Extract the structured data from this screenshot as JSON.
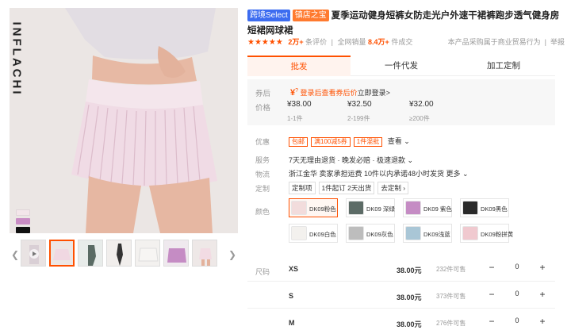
{
  "brand": "INFLACHI",
  "colors": {
    "accent": "#ff5000",
    "badge_blue": "#3c6cf0",
    "badge_orange": "#ff7a2f"
  },
  "gallery": {
    "swatches": [
      "#f3e6ea",
      "#c98cc4",
      "#111111"
    ],
    "thumb_count": 8,
    "prev_icon": "chevron-left-icon",
    "next_icon": "chevron-right-icon"
  },
  "title": {
    "badges": [
      "跨境Select",
      "镇店之宝"
    ],
    "text": "夏季运动健身短裤女防走光户外速干裙裤跑步透气健身房短裙网球裙"
  },
  "rating": {
    "stars": 5,
    "score": "2万+",
    "score_label": "条评价",
    "sales_label": "全网销量",
    "sales": "8.4万+",
    "sales_unit": "件成交",
    "note": "本产品采购属于商业贸易行为",
    "report": "举报"
  },
  "tabs": [
    "批发",
    "一件代发",
    "加工定制"
  ],
  "pricebox": {
    "coupon_label": "券后",
    "coupon_text": "登录后查看券后价",
    "coupon_link": "立即登录>",
    "price_label": "价格",
    "tiers": [
      {
        "price": "¥38.00",
        "qty": "1-1件"
      },
      {
        "price": "¥32.50",
        "qty": "2-199件"
      },
      {
        "price": "¥32.00",
        "qty": "≥200件"
      }
    ]
  },
  "promo": {
    "label": "优惠",
    "tags": [
      "包邮",
      "满100减5券",
      "1件混批"
    ],
    "more": "查看"
  },
  "service": {
    "label": "服务",
    "value": "7天无理由退货 · 晚发必赔 · 极速退款"
  },
  "logistics": {
    "label": "物流",
    "value": "浙江金华  卖家承担运费  10件以内承诺48小时发货  更多"
  },
  "custom": {
    "label": "定制",
    "items": [
      "定制项",
      "1件起订 2天出货",
      "去定制"
    ]
  },
  "color_options": {
    "label": "颜色",
    "items": [
      {
        "name": "DK09粉色",
        "swatch": "#f2dcdc",
        "selected": true
      },
      {
        "name": "DK09 深绿",
        "swatch": "#5c6b66",
        "selected": false
      },
      {
        "name": "DK09 紫色",
        "swatch": "#c58cc4",
        "selected": false
      },
      {
        "name": "DK09黑色",
        "swatch": "#2a2a2a",
        "selected": false
      },
      {
        "name": "DK09白色",
        "swatch": "#f3f1ee",
        "selected": false
      },
      {
        "name": "DK09灰色",
        "swatch": "#bdbdbd",
        "selected": false
      },
      {
        "name": "DK09浅蓝",
        "swatch": "#a9c6d6",
        "selected": false
      },
      {
        "name": "DK09粉拼黄",
        "swatch": "#f0c9cf",
        "selected": false
      }
    ]
  },
  "sizes": {
    "label": "尺码",
    "rows": [
      {
        "size": "XS",
        "price": "38.00元",
        "stock": "232件可售",
        "qty": "0"
      },
      {
        "size": "S",
        "price": "38.00元",
        "stock": "373件可售",
        "qty": "0"
      },
      {
        "size": "M",
        "price": "38.00元",
        "stock": "276件可售",
        "qty": "0"
      }
    ],
    "minus": "−",
    "plus": "+"
  }
}
